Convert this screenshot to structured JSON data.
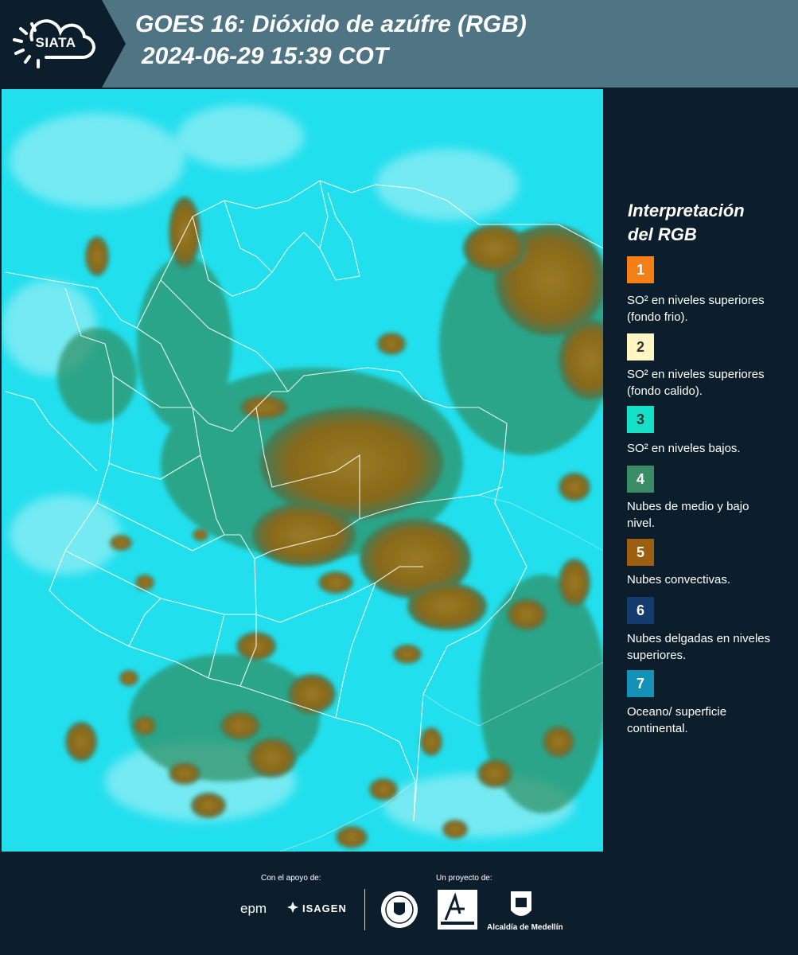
{
  "header": {
    "logo_text": "SIATA",
    "title_line1": "GOES 16: Dióxido de azúfre (RGB)",
    "title_line2": "2024-06-29 15:39 COT"
  },
  "legend": {
    "title_line1": "Interpretación",
    "title_line2": "del RGB",
    "items": [
      {
        "number": "1",
        "color": "#f57f17",
        "label": "SO² en niveles superiores (fondo frio)."
      },
      {
        "number": "2",
        "color": "#fff6c4",
        "label": "SO² en niveles superiores (fondo calido)."
      },
      {
        "number": "3",
        "color": "#14e1c8",
        "label": "SO² en niveles bajos."
      },
      {
        "number": "4",
        "color": "#3a8c64",
        "label": "Nubes de medio y bajo nivel."
      },
      {
        "number": "5",
        "color": "#9c5f12",
        "label": "Nubes convectivas."
      },
      {
        "number": "6",
        "color": "#143a6e",
        "label": "Nubes delgadas en niveles superiores."
      },
      {
        "number": "7",
        "color": "#1591b8",
        "label": "Oceano/ superficie continental."
      }
    ]
  },
  "footer": {
    "support_label": "Con el apoyo de:",
    "project_label": "Un proyecto de:",
    "sponsors": [
      "epm",
      "ISAGEN"
    ],
    "partners": [
      "Área Metropolitana Valle de Aburrá",
      "Alcaldía de Medellín"
    ],
    "alcaldia_text": "Alcaldía de Medellín"
  },
  "map": {
    "background_color": "#22dfee",
    "cloud_color": "#8a6a1e"
  }
}
